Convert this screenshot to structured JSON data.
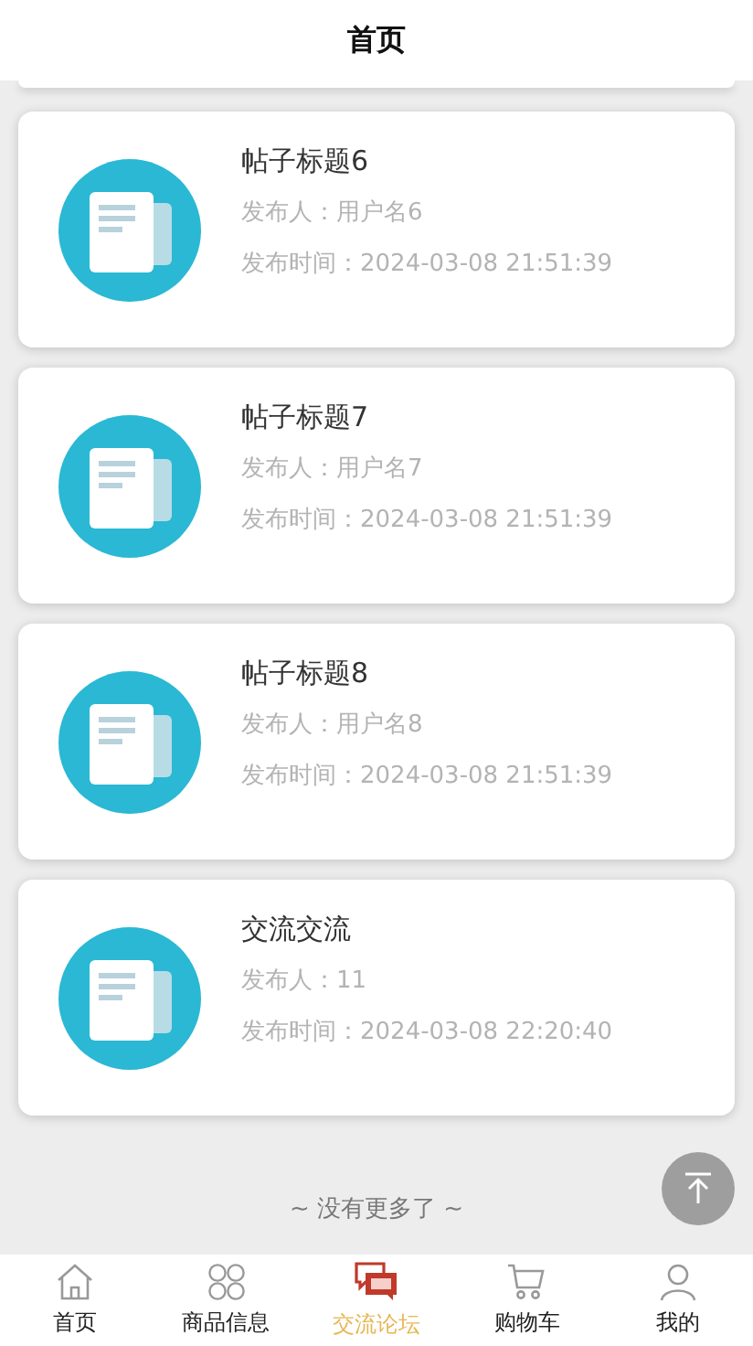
{
  "header": {
    "title": "首页"
  },
  "posts": [
    {
      "title": "帖子标题6",
      "author": "发布人：用户名6",
      "time": "发布时间：2024-03-08 21:51:39"
    },
    {
      "title": "帖子标题7",
      "author": "发布人：用户名7",
      "time": "发布时间：2024-03-08 21:51:39"
    },
    {
      "title": "帖子标题8",
      "author": "发布人：用户名8",
      "time": "发布时间：2024-03-08 21:51:39"
    },
    {
      "title": "交流交流",
      "author": "发布人：11",
      "time": "发布时间：2024-03-08 22:20:40"
    }
  ],
  "end_text": "~ 没有更多了 ~",
  "tabs": [
    {
      "label": "首页",
      "kind": "home",
      "selected": false
    },
    {
      "label": "商品信息",
      "kind": "grid",
      "selected": false
    },
    {
      "label": "交流论坛",
      "kind": "chat",
      "selected": true
    },
    {
      "label": "购物车",
      "kind": "cart",
      "selected": false
    },
    {
      "label": "我的",
      "kind": "user",
      "selected": false
    }
  ]
}
